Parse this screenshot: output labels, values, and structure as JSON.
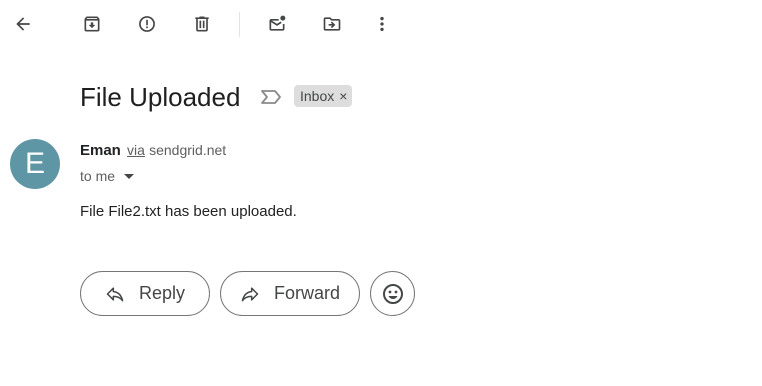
{
  "toolbar": {
    "back": "back-arrow-icon",
    "archive": "archive-icon",
    "spam": "report-spam-icon",
    "delete": "trash-icon",
    "unread": "mark-unread-icon",
    "move": "move-to-icon",
    "more": "more-vert-icon"
  },
  "email": {
    "subject": "File Uploaded",
    "label": "Inbox",
    "label_remove": "×",
    "avatar_letter": "E",
    "avatar_color": "#5f96a6",
    "sender_name": "Eman",
    "sender_via": "via",
    "sender_domain": "sendgrid.net",
    "recipient": "to me",
    "body": "File File2.txt has been uploaded."
  },
  "actions": {
    "reply_label": "Reply",
    "forward_label": "Forward",
    "emoji": "emoji-react-icon"
  }
}
